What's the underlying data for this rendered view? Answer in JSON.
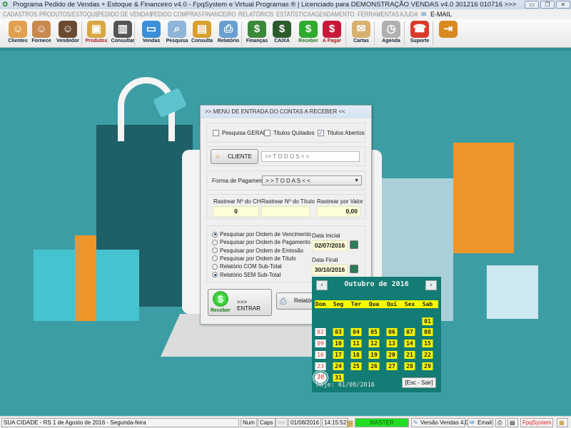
{
  "window": {
    "title": "Programa Pedido de Vendas + Estoque & Financeiro v4.0 - FpqSystem e Virtual Programas ® | Licenciado para  DEMONSTRAÇÃO VENDAS v4.0 301216 010716 >>>",
    "minimize": "▭",
    "restore": "❐",
    "close": "✕"
  },
  "menu": [
    "CADASTROS",
    "PRODUTOS/ESTOQUE",
    "PEDIDO DE VENDAS",
    "PEDIDO COMPRAS",
    "FINANCEIRO",
    "RELATÓRIOS",
    "ESTATÍSTICA",
    "AGENDAMENTO",
    "FERRAMENTAS",
    "AJUDA"
  ],
  "menu_email": "E-MAIL",
  "toolbar": [
    {
      "label": "Clientes",
      "icon": "clients-icon",
      "color": "#e0a050",
      "glyph": "☺"
    },
    {
      "label": "Fornece",
      "icon": "supplier-icon",
      "color": "#c98850",
      "glyph": "☺"
    },
    {
      "label": "Vendedor",
      "icon": "seller-icon",
      "color": "#6a4a30",
      "glyph": "☺"
    },
    {
      "label": "Produtos",
      "icon": "products-box-icon",
      "color": "#d9a640",
      "glyph": "▣"
    },
    {
      "label": "Consultar",
      "icon": "barcode-icon",
      "color": "#555555",
      "glyph": "▥"
    },
    {
      "label": "Vendas",
      "icon": "monitor-icon",
      "color": "#3b8fd8",
      "glyph": "▭"
    },
    {
      "label": "Pesquisa",
      "icon": "search-docs-icon",
      "color": "#8fb5d8",
      "glyph": "⌕"
    },
    {
      "label": "Consulta",
      "icon": "folder-box-icon",
      "color": "#d9a030",
      "glyph": "▤"
    },
    {
      "label": "Relatório",
      "icon": "printer-icon",
      "color": "#6aa0d0",
      "glyph": "⎙"
    },
    {
      "label": "Finanças",
      "icon": "finance-chart-icon",
      "color": "#3a8a3a",
      "glyph": "$"
    },
    {
      "label": "CAIXA",
      "icon": "cash-book-icon",
      "color": "#2d5a2d",
      "glyph": "$"
    },
    {
      "label": "Receber",
      "icon": "receive-money-icon",
      "color": "#2eaa2e",
      "glyph": "$"
    },
    {
      "label": "A Pagar",
      "icon": "pay-money-icon",
      "color": "#c8183a",
      "glyph": "$"
    },
    {
      "label": "Cartas",
      "icon": "letter-scroll-icon",
      "color": "#d8b070",
      "glyph": "✉"
    },
    {
      "label": "Agenda",
      "icon": "calendar-clock-icon",
      "color": "#b0b0b0",
      "glyph": "◷"
    },
    {
      "label": "Suporte",
      "icon": "support-agent-icon",
      "color": "#d83a2a",
      "glyph": "☎"
    },
    {
      "label": "",
      "icon": "exit-door-icon",
      "color": "#d88a20",
      "glyph": "⇥"
    }
  ],
  "dialog": {
    "title": ">>  MENU DE ENTRADA DO CONTAS A RECEBER  <<",
    "checks": [
      {
        "label": "Pesquisa GERAL",
        "checked": false
      },
      {
        "label": "Titulos Quitados",
        "checked": false
      },
      {
        "label": "Titulos Abertos",
        "checked": true
      }
    ],
    "cliente_button": "CLIENTE",
    "cliente_value": ">> T O D O S < <",
    "forma_label": "Forma de Pagamento",
    "forma_value": "> > T O D A S < <",
    "rastrear": [
      {
        "label": "Rastrear Nº do CH",
        "value": "0"
      },
      {
        "label": "Rastrear Nº do Título",
        "value": ""
      },
      {
        "label": "Rastrear por Valor",
        "value": "0,00"
      }
    ],
    "radios": [
      {
        "label": "Pesquisar por Ordem de Vencimento",
        "selected": true
      },
      {
        "label": "Pesquisar por Ordem de Pagamento",
        "selected": false
      },
      {
        "label": "Pesquisar por Ordem de Emissão",
        "selected": false
      },
      {
        "label": "Pesquisar por Ordem de Título",
        "selected": false
      },
      {
        "label": "Relatório COM Sub-Total",
        "selected": false
      },
      {
        "label": "Relatório SEM Sub-Total",
        "selected": true
      }
    ],
    "data_inicial_label": "Data Inicial",
    "data_inicial": "02/07/2016",
    "data_final_label": "Data Final",
    "data_final": "30/10/2016",
    "entrar_icon_label": "Receber",
    "entrar_label": ">>> ENTRAR",
    "relatorio_label": "Relatório"
  },
  "calendar": {
    "title": "Outubro de 2016",
    "prev": "‹",
    "next": "›",
    "weekdays": [
      "Dom",
      "Seg",
      "Ter",
      "Qua",
      "Qui",
      "Sex",
      "Sab"
    ],
    "first_weekday": 6,
    "days_in_month": 31,
    "selected_day": 30,
    "today": "Hoje: 01/08/2016",
    "esc": "[Esc - Sair]"
  },
  "status": {
    "city": "SUA CIDADE - RS  1 de Agosto de 2016 - Segunda-feira",
    "num": "Num",
    "caps": "Caps",
    "ins": "Ins",
    "date": "01/08/2016",
    "time": "14:15:52",
    "user": "MASTER",
    "version": "Versão Vendas 4.0",
    "email": "Email",
    "brand": "FpqSystem"
  },
  "colors": {
    "background": "#3d9da5",
    "calendar": "#137c74",
    "highlight": "#f5f500",
    "master": "#22dd22"
  }
}
